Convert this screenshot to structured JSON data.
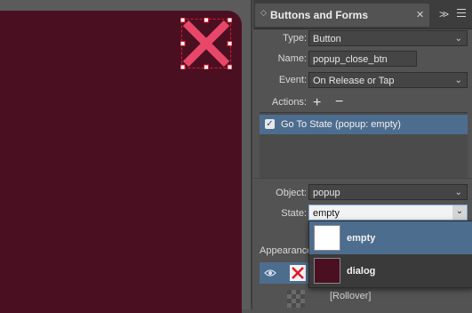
{
  "panel": {
    "title": "Buttons and Forms"
  },
  "form": {
    "type_label": "Type:",
    "type_value": "Button",
    "name_label": "Name:",
    "name_value": "popup_close_btn",
    "event_label": "Event:",
    "event_value": "On Release or Tap",
    "actions_label": "Actions:",
    "object_label": "Object:",
    "object_value": "popup",
    "state_label": "State:",
    "state_value": "empty"
  },
  "actions": [
    {
      "label": "Go To State (popup: empty)",
      "checked": true
    }
  ],
  "state_options": [
    {
      "label": "empty",
      "selected": true,
      "thumb_color": "#ffffff"
    },
    {
      "label": "dialog",
      "selected": false,
      "thumb_color": "#4a1022"
    }
  ],
  "appearance": {
    "label": "Appearance",
    "rollover_label": "[Rollover]"
  },
  "colors": {
    "accent": "#4d6d8f",
    "page_fill": "#4a1022",
    "close_icon": "#e8476a",
    "selection": "#e0192c"
  }
}
